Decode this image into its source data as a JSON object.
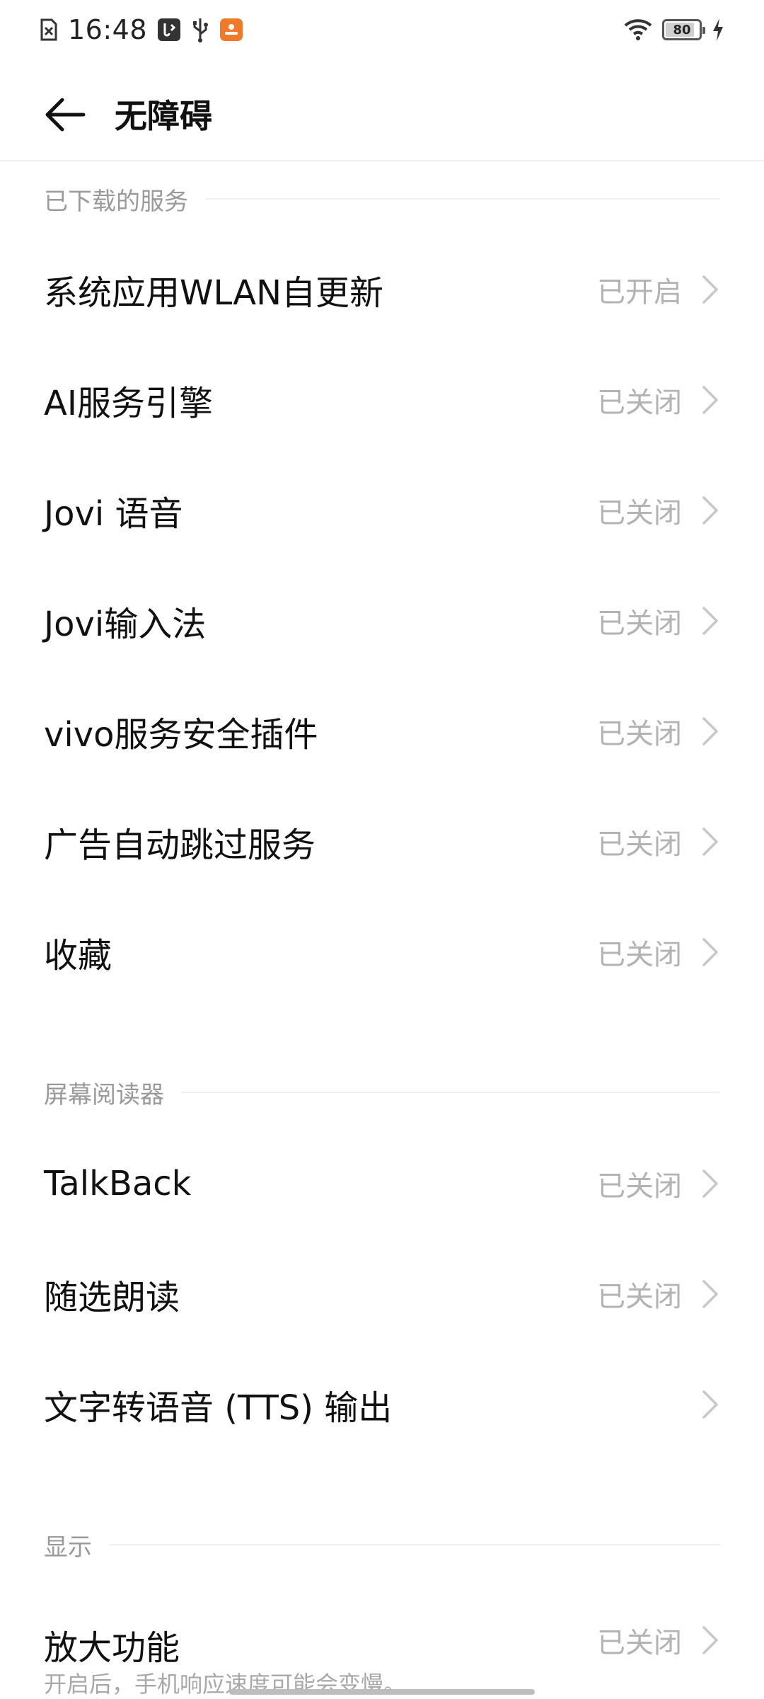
{
  "status_bar": {
    "time": "16:48",
    "battery_level": "80",
    "icons_left": [
      "sim-off-icon",
      "usb-debug-icon",
      "usb-icon",
      "notification-app-icon"
    ],
    "icons_right": [
      "wifi-icon",
      "battery-icon",
      "charging-icon"
    ]
  },
  "header": {
    "title": "无障碍",
    "back_icon": "back-arrow-icon"
  },
  "sections": [
    {
      "title": "已下载的服务",
      "items": [
        {
          "label": "系统应用WLAN自更新",
          "status": "已开启"
        },
        {
          "label": "AI服务引擎",
          "status": "已关闭"
        },
        {
          "label": "Jovi 语音",
          "status": "已关闭"
        },
        {
          "label": "Jovi输入法",
          "status": "已关闭"
        },
        {
          "label": "vivo服务安全插件",
          "status": "已关闭"
        },
        {
          "label": "广告自动跳过服务",
          "status": "已关闭"
        },
        {
          "label": "收藏",
          "status": "已关闭"
        }
      ]
    },
    {
      "title": "屏幕阅读器",
      "items": [
        {
          "label": "TalkBack",
          "status": "已关闭"
        },
        {
          "label": "随选朗读",
          "status": "已关闭"
        },
        {
          "label": "文字转语音 (TTS) 输出",
          "status": ""
        }
      ]
    },
    {
      "title": "显示",
      "items": [
        {
          "label": "放大功能",
          "subtitle": "开启后，手机响应速度可能会变慢。",
          "status": "已关闭"
        }
      ]
    }
  ],
  "colors": {
    "primary_text": "#111111",
    "secondary_text": "#b3b3b3",
    "section_title": "#9a9a9a",
    "notification_icon_bg": "#f07a2a"
  }
}
